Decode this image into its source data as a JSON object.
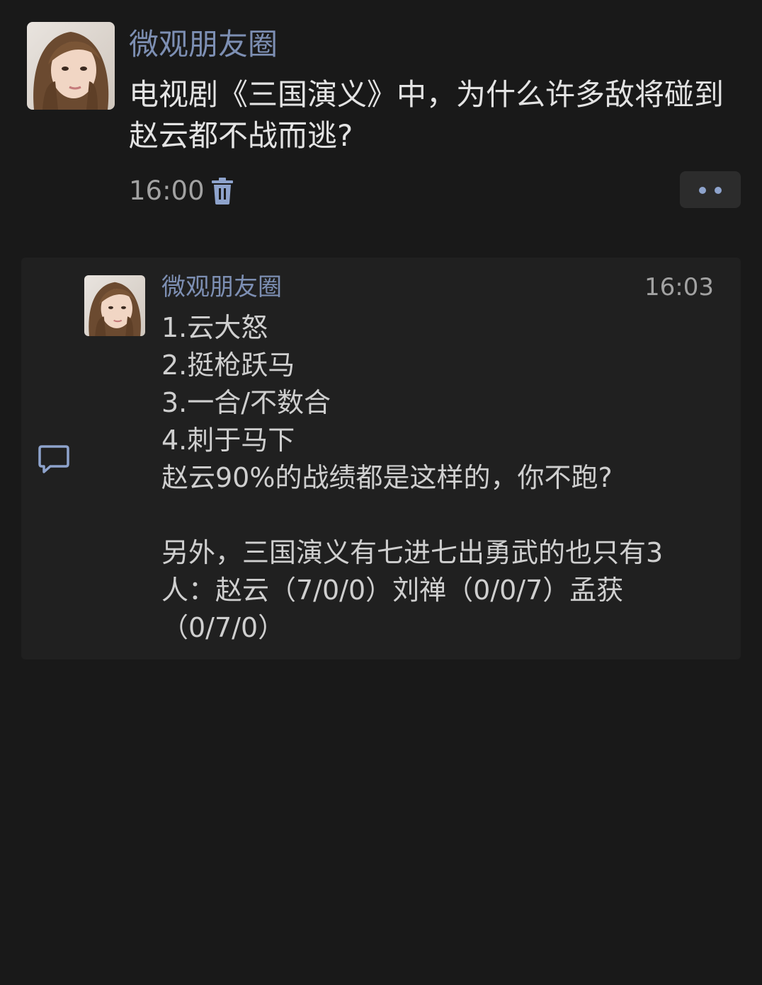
{
  "post": {
    "author": "微观朋友圈",
    "text": "电视剧《三国演义》中，为什么许多敌将碰到赵云都不战而逃?",
    "time": "16:00",
    "icons": {
      "delete": "trash-icon",
      "more": "more-dots-icon"
    }
  },
  "comment": {
    "author": "微观朋友圈",
    "time": "16:03",
    "text": "1.云大怒\n2.挺枪跃马\n3.一合/不数合\n4.刺于马下\n赵云90%的战绩都是这样的，你不跑?\n\n另外，三国演义有七进七出勇武的也只有3人：赵云（7/0/0）刘禅（0/0/7）孟获（0/7/0）",
    "icons": {
      "comment": "comment-bubble-icon"
    }
  },
  "colors": {
    "background": "#191919",
    "name_accent": "#7d8fb3",
    "comment_panel": "#202020"
  }
}
